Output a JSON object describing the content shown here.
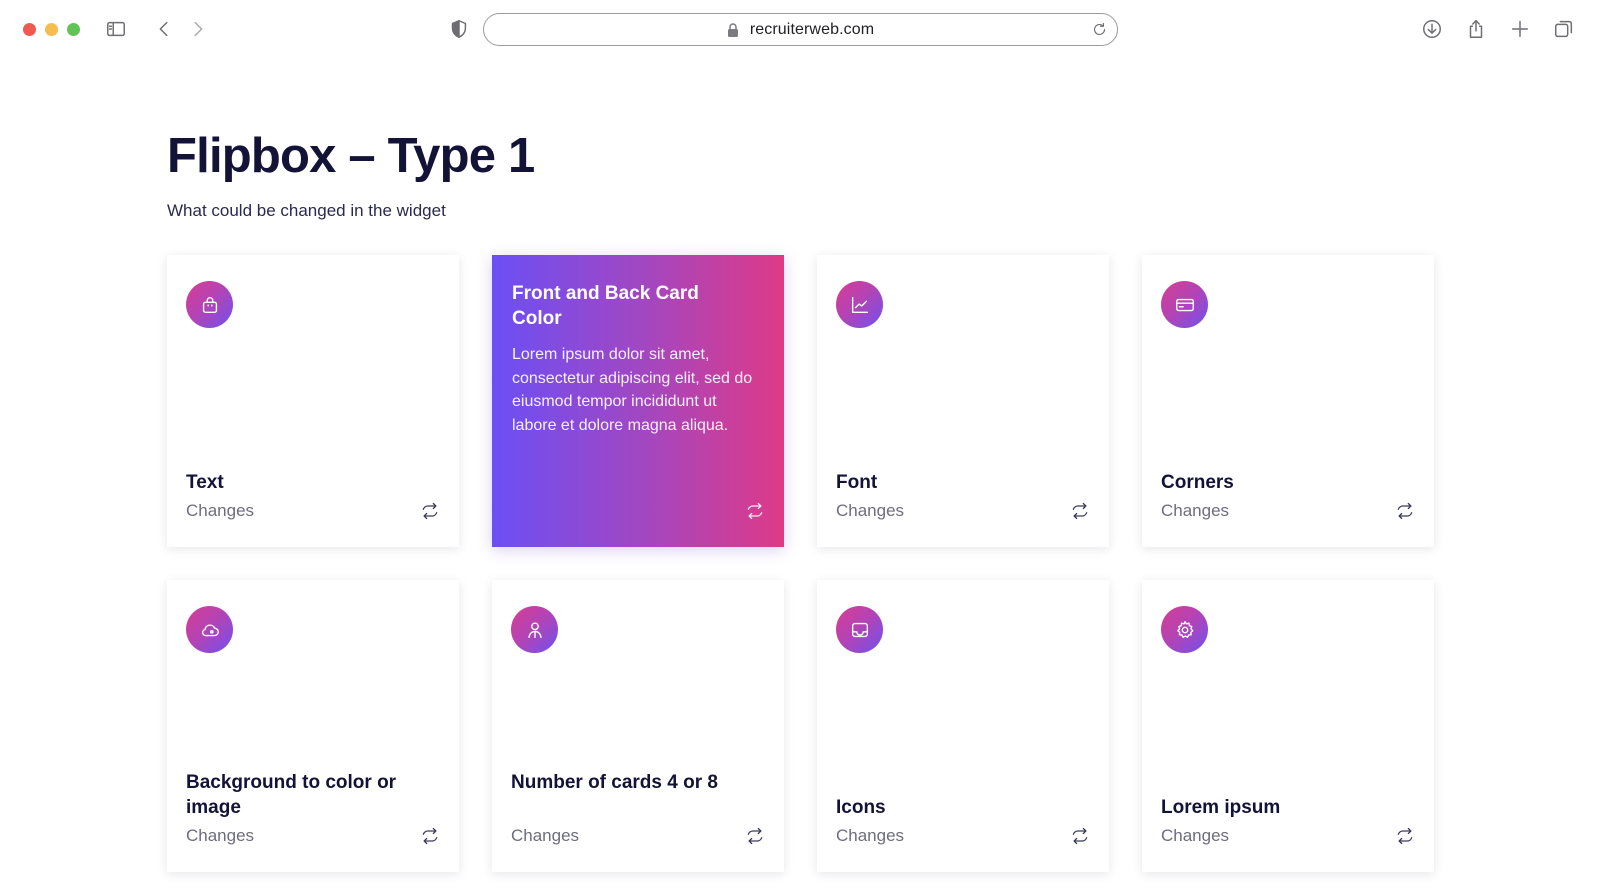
{
  "browser": {
    "url": "recruiterweb.com"
  },
  "page": {
    "title": "Flipbox – Type 1",
    "subtitle": "What could be changed in the widget"
  },
  "cards": [
    {
      "title": "Text",
      "sub": "Changes",
      "icon": "shopping-bag-icon"
    },
    {
      "back_title": "Front and Back Card Color",
      "back_body": "Lorem ipsum dolor sit amet, consectetur adipiscing elit, sed do eiusmod tempor incididunt ut labore et dolore magna aliqua.",
      "icon": "flip-icon"
    },
    {
      "title": "Font",
      "sub": "Changes",
      "icon": "chart-line-icon"
    },
    {
      "title": "Corners",
      "sub": "Changes",
      "icon": "credit-card-icon"
    },
    {
      "title": "Background to color or image",
      "sub": "Changes",
      "icon": "cloud-icon"
    },
    {
      "title": "Number of cards 4 or 8",
      "sub": "Changes",
      "icon": "user-icon"
    },
    {
      "title": "Icons",
      "sub": "Changes",
      "icon": "inbox-icon"
    },
    {
      "title": "Lorem ipsum",
      "sub": "Changes",
      "icon": "gear-icon"
    }
  ],
  "colors": {
    "accent_start": "#6b4ff6",
    "accent_end": "#df3a86",
    "title_text": "#131237"
  }
}
